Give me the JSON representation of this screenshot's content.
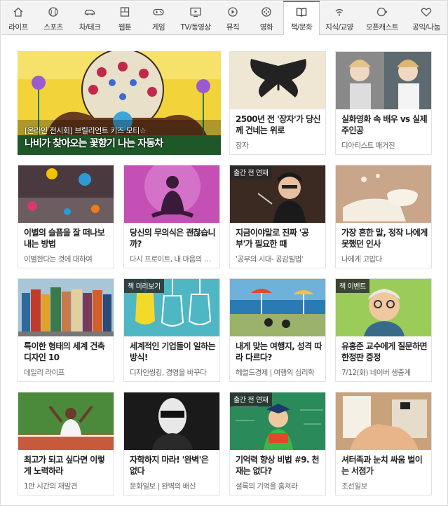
{
  "tabs": [
    {
      "label": "라이프",
      "icon": "house-icon"
    },
    {
      "label": "스포츠",
      "icon": "baseball-icon"
    },
    {
      "label": "차/테크",
      "icon": "car-icon"
    },
    {
      "label": "웹툰",
      "icon": "webtoon-icon"
    },
    {
      "label": "게임",
      "icon": "gamepad-icon"
    },
    {
      "label": "TV/동영상",
      "icon": "tv-play-icon"
    },
    {
      "label": "뮤직",
      "icon": "music-play-icon"
    },
    {
      "label": "영화",
      "icon": "film-reel-icon"
    },
    {
      "label": "책/문화",
      "icon": "open-book-icon",
      "active": true
    },
    {
      "label": "지식/교양",
      "icon": "knowledge-icon"
    },
    {
      "label": "오픈캐스트",
      "icon": "opencast-icon"
    },
    {
      "label": "공익/나눔",
      "icon": "heart-icon"
    }
  ],
  "feature": {
    "tag": "[온라인 전시회] 브릴리언트 키즈 모티☆",
    "title": "나비가 찾아오는 꽃향기 나는 자동차"
  },
  "cards": [
    {
      "title": "2500년 전 '장자'가 당신께 건네는 위로",
      "source": "장자",
      "badge": ""
    },
    {
      "title": "실화영화 속 배우 vs 실제 주인공",
      "source": "디아티스트 매거진",
      "badge": ""
    },
    {
      "title": "이별의 슬픔을 잘 떠나보내는 방법",
      "source": "이별한다는 것에 대하여",
      "badge": ""
    },
    {
      "title": "당신의 무의식은 괜찮습니까?",
      "source": "다시 프로이트, 내 마음의 상처...",
      "badge": ""
    },
    {
      "title": "지금이야말로 진짜 '공부'가 필요한 때",
      "source": "'공부의 시대- 공감필법'",
      "badge": "출간 전 연재"
    },
    {
      "title": "가장 흔한 말, 정작 나에게 못했던 인사",
      "source": "나에게 고맙다",
      "badge": ""
    },
    {
      "title": "특이한 형태의 세계 건축 디자인 10",
      "source": "데일리 라이프",
      "badge": ""
    },
    {
      "title": "세계적인 기업들이 일하는 방식!",
      "source": "디자인씽킹, 경영을 바꾸다",
      "badge": "책 미리보기"
    },
    {
      "title": "내게 맞는 여행지, 성격 따라 다르다?",
      "source": "헤럴드경제 | 여행의 심리학",
      "badge": ""
    },
    {
      "title": "유홍준 교수에게 질문하면 한정판 증정",
      "source": "7/12(화) 네이버 생중계",
      "badge": "책 이벤트"
    },
    {
      "title": "최고가 되고 싶다면 이렇게 노력하라",
      "source": "1만 시간의 재발견",
      "badge": ""
    },
    {
      "title": "자학하지 마라! '완벽'은 없다",
      "source": "문화일보 | 완벽의 배신",
      "badge": ""
    },
    {
      "title": "기억력 향상 비법 #9. 천재는 없다?",
      "source": "셜록의 기억을 훔쳐라",
      "badge": "출간 전 연재"
    },
    {
      "title": "셔터족과 눈치 싸움 벌이는 서점가",
      "source": "조선일보",
      "badge": ""
    }
  ],
  "colors": {
    "tab_bg": "#f3f3f3",
    "tab_active_bg": "#ffffff",
    "border": "#e2e2e2",
    "title_text": "#222222",
    "source_text": "#666666",
    "badge_bg": "#333333"
  }
}
